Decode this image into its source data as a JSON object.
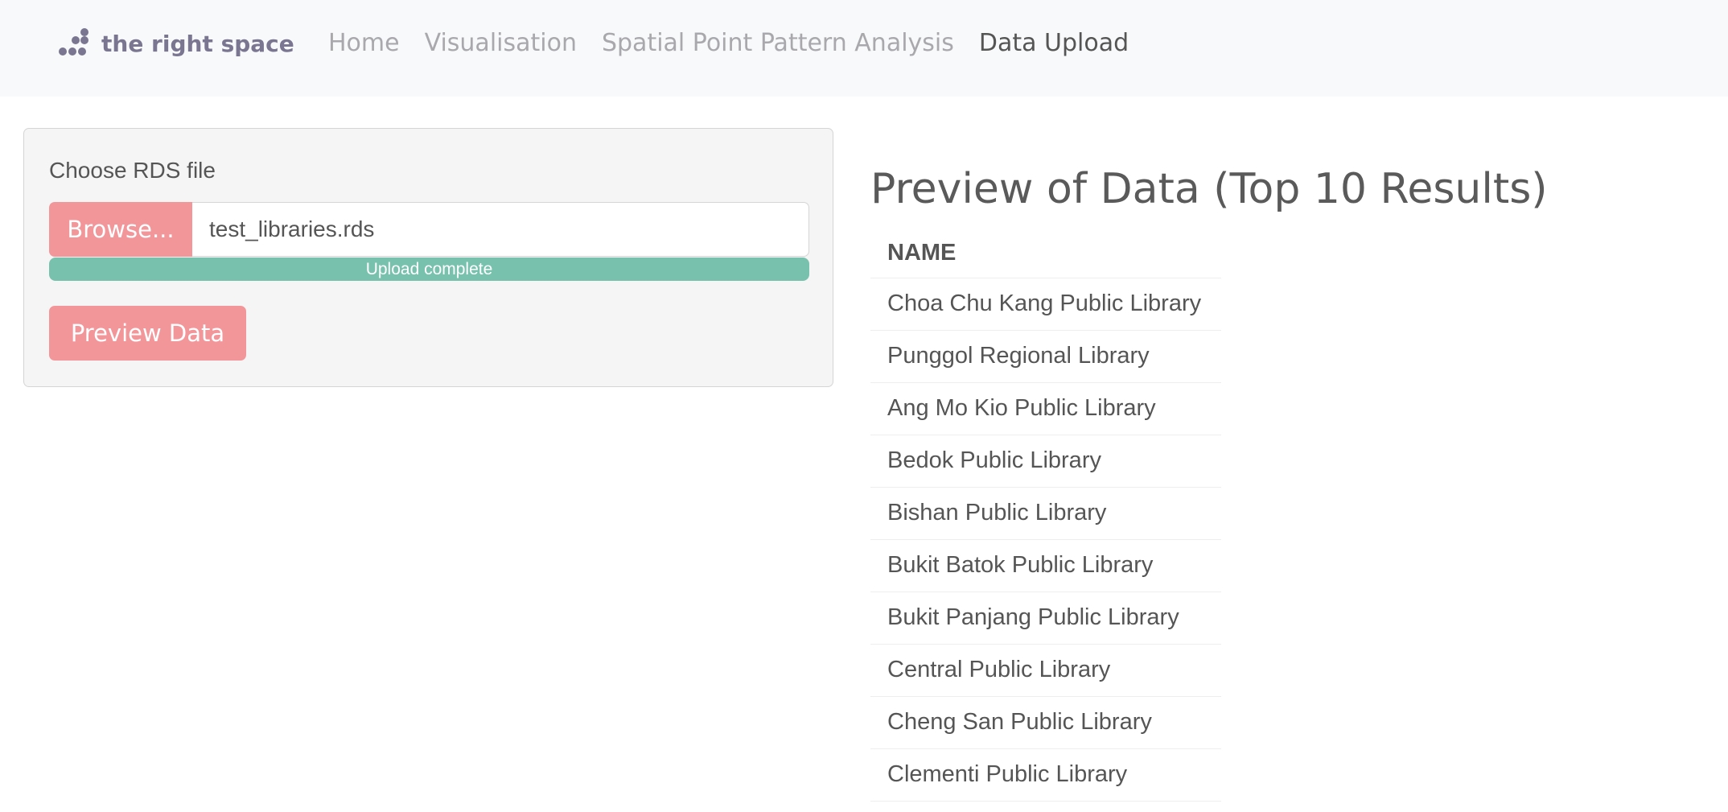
{
  "brand": {
    "name": "the right space"
  },
  "nav": {
    "items": [
      {
        "label": "Home"
      },
      {
        "label": "Visualisation"
      },
      {
        "label": "Spatial Point Pattern Analysis"
      },
      {
        "label": "Data Upload"
      }
    ],
    "active": "Data Upload"
  },
  "upload": {
    "label": "Choose RDS file",
    "browse_label": "Browse...",
    "file_name": "test_libraries.rds",
    "progress_text": "Upload complete",
    "progress_fraction": 1.0,
    "preview_button": "Preview Data"
  },
  "preview": {
    "title": "Preview of Data (Top 10 Results)",
    "columns": [
      "NAME"
    ],
    "rows": [
      "Choa Chu Kang Public Library",
      "Punggol Regional Library",
      "Ang Mo Kio Public Library",
      "Bedok Public Library",
      "Bishan Public Library",
      "Bukit Batok Public Library",
      "Bukit Panjang Public Library",
      "Central Public Library",
      "Cheng San Public Library",
      "Clementi Public Library"
    ]
  },
  "colors": {
    "accent": "#f3969a",
    "success": "#78c2ad",
    "brand_text": "#7a7691",
    "navbar_bg": "#f8f9fa"
  },
  "icons": {
    "brand_logo": "dots-logo-icon"
  }
}
